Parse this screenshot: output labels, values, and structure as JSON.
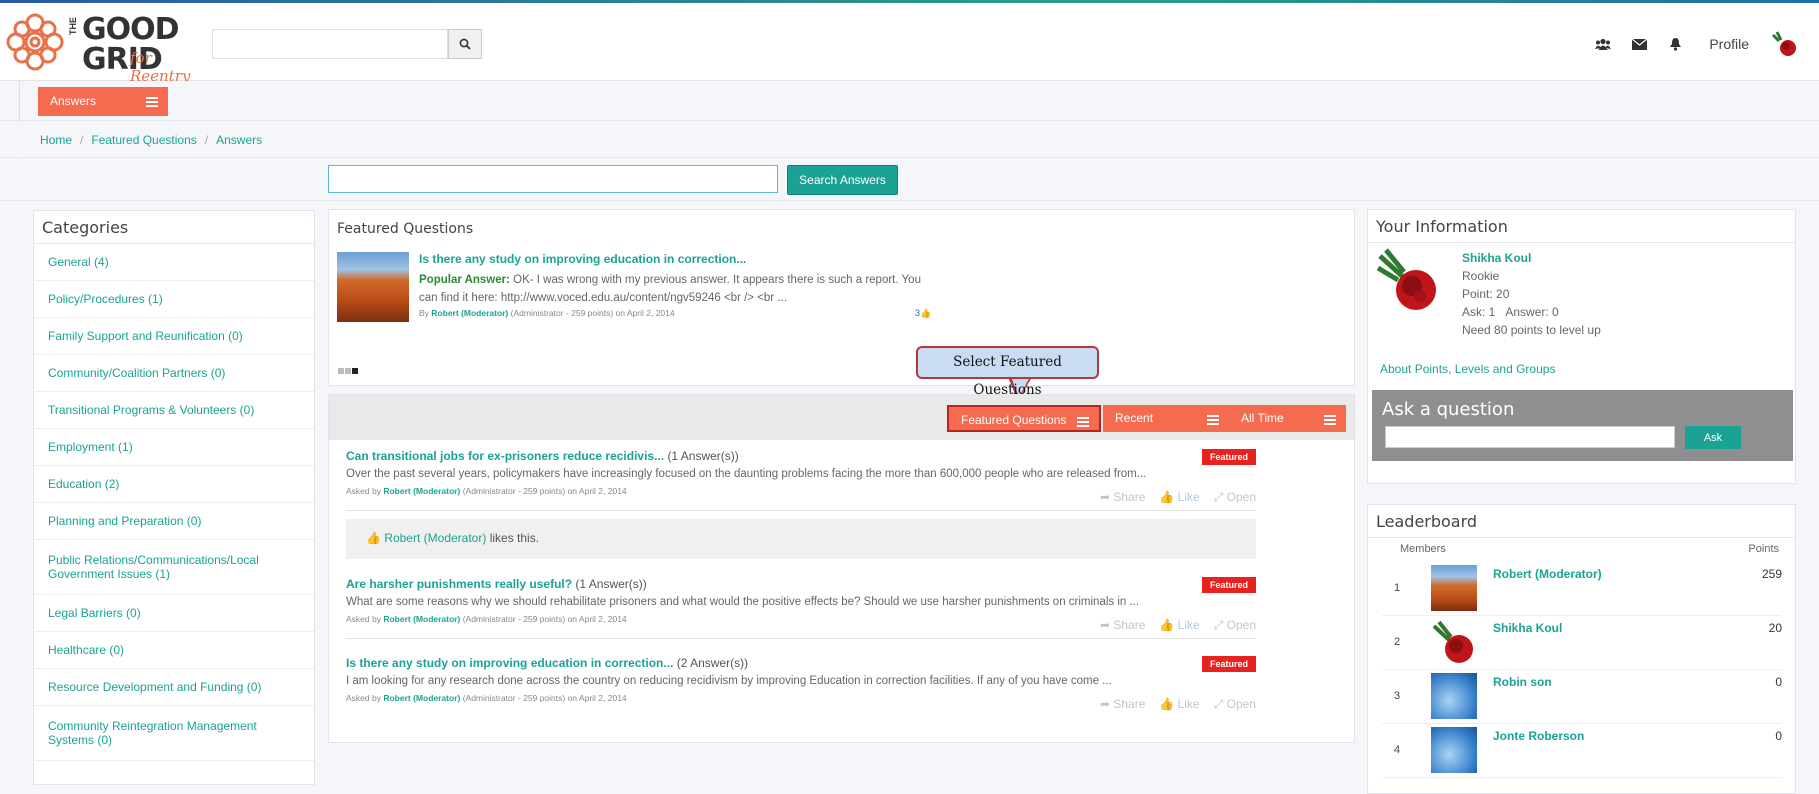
{
  "header": {
    "logo_line1": "GOOD",
    "logo_line2": "GRID",
    "logo_the": "THE",
    "logo_script": "for Reentry",
    "search_placeholder": "",
    "profile_label": "Profile"
  },
  "answers_menu": {
    "label": "Answers"
  },
  "breadcrumb": [
    "Home",
    "Featured Questions",
    "Answers"
  ],
  "answer_search": {
    "value": "",
    "button_label": "Search Answers"
  },
  "categories": {
    "title": "Categories",
    "items": [
      "General (4)",
      "Policy/Procedures (1)",
      "Family Support and Reunification (0)",
      "Community/Coalition Partners (0)",
      "Transitional Programs & Volunteers (0)",
      "Employment (1)",
      "Education (2)",
      "Planning and Preparation (0)",
      "Public Relations/Communications/Local Government Issues (1)",
      "Legal Barriers (0)",
      "Healthcare (0)",
      "Resource Development and Funding (0)",
      "Community Reintegration Management Systems (0)"
    ]
  },
  "featured": {
    "title": "Featured Questions",
    "question": "Is there any study on improving education in correction...",
    "popular_label": "Popular Answer:",
    "answer_text": "OK- I was wrong with my previous answer. It appears there is such a report. You can find it here: http://www.voced.edu.au/content/ngv59246 <br /> <br ...",
    "by_prefix": "By",
    "by_user": "Robert (Moderator)",
    "by_suffix": "(Administrator - 259 points)  on April 2, 2014",
    "likes": "3"
  },
  "tooltip": "Select Featured Questions",
  "toolbar": {
    "featured": "Featured Questions",
    "recent": "Recent",
    "all_time": "All Time"
  },
  "questions": [
    {
      "title": "Can transitional jobs for ex-prisoners reduce recidivis...",
      "count": "(1 Answer(s))",
      "body": "Over the past several years, policymakers have increasingly focused on the daunting problems facing the more than 600,000 people who are released from...",
      "asked_prefix": "Asked by",
      "user": "Robert (Moderator)",
      "meta": "(Administrator - 259 points)  on April 2, 2014",
      "badge": "Featured"
    },
    {
      "title": "Are harsher punishments really useful?",
      "count": "(1 Answer(s))",
      "body": "What are some reasons why we should rehabilitate prisoners and what would the positive effects be? Should we use harsher punishments on criminals in ...",
      "asked_prefix": "Asked by",
      "user": "Robert (Moderator)",
      "meta": "(Administrator - 259 points)  on April 2, 2014",
      "badge": "Featured"
    },
    {
      "title": "Is there any study on improving education in correction...",
      "count": "(2 Answer(s))",
      "body": "I am looking for any research done across the country on reducing recidivism by improving Education in correction facilities. If any of you have come ...",
      "asked_prefix": "Asked by",
      "user": "Robert (Moderator)",
      "meta": "(Administrator - 259 points)  on April 2, 2014",
      "badge": "Featured"
    }
  ],
  "actions": {
    "share": "Share",
    "like": "Like",
    "open": "Open"
  },
  "likes_box": {
    "user": "Robert (Moderator)",
    "text": "likes this."
  },
  "your_info": {
    "title": "Your Information",
    "name": "Shikha Koul",
    "level": "Rookie",
    "points": "Point: 20",
    "ask": "Ask: 1",
    "answer": "Answer: 0",
    "need": "Need 80 points to level up",
    "link": "About Points, Levels and Groups",
    "ask_title": "Ask a question",
    "ask_btn": "Ask"
  },
  "leaderboard": {
    "title": "Leaderboard",
    "col_members": "Members",
    "col_points": "Points",
    "rows": [
      {
        "rank": "1",
        "name": "Robert (Moderator)",
        "points": "259",
        "avatar": "desert"
      },
      {
        "rank": "2",
        "name": "Shikha Koul",
        "points": "20",
        "avatar": "rose"
      },
      {
        "rank": "3",
        "name": "Robin son",
        "points": "0",
        "avatar": "blue"
      },
      {
        "rank": "4",
        "name": "Jonte Roberson",
        "points": "0",
        "avatar": "blue"
      }
    ]
  },
  "colors": {
    "accent": "#1aa394",
    "orange": "#f56b4f",
    "badge": "#e8231f"
  }
}
